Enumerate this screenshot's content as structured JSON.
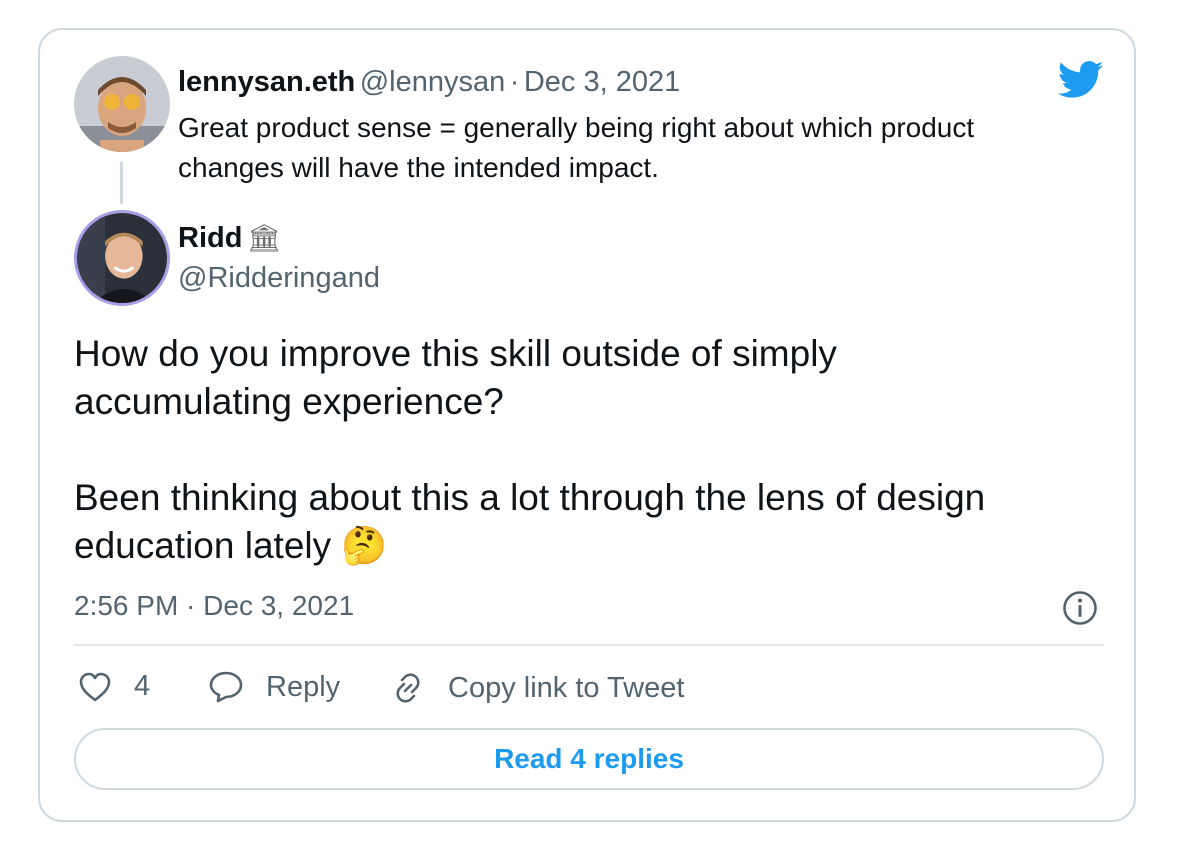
{
  "quoted": {
    "name": "lennysan.eth",
    "handle": "@lennysan",
    "sep": "·",
    "date": "Dec 3, 2021",
    "text": "Great product sense = generally being right about which product changes will have the intended impact."
  },
  "tweet": {
    "name": "Ridd",
    "badge": "🏛",
    "handle": "@Ridderingand",
    "text_p1": "How do you improve this skill outside of simply accumulating experience?",
    "text_p2": "Been thinking about this a lot through the lens of design education lately",
    "emoji": "🤔",
    "timestamp": "2:56 PM · Dec 3, 2021"
  },
  "actions": {
    "like_count": "4",
    "reply_label": "Reply",
    "copy_label": "Copy link to Tweet"
  },
  "read_replies_label": "Read 4 replies",
  "icons": [
    "twitter-bird-icon",
    "info-icon",
    "heart-icon",
    "reply-icon",
    "link-icon"
  ],
  "colors": {
    "accent": "#1d9bf0",
    "muted": "#536471",
    "border": "#cfd9de",
    "text": "#0f1419"
  }
}
